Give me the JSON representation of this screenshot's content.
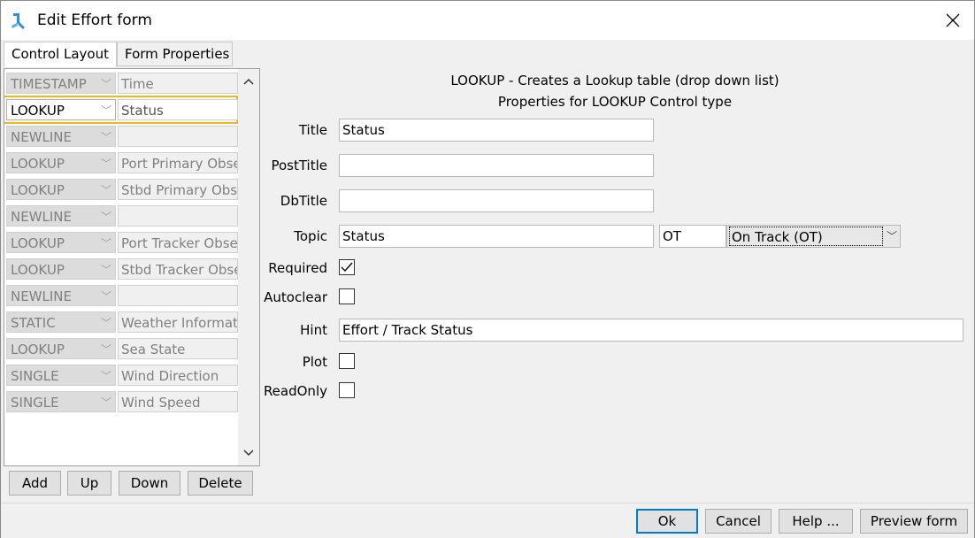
{
  "window": {
    "title": "Edit Effort form"
  },
  "tabs": [
    {
      "label": "Control Layout",
      "active": true
    },
    {
      "label": "Form Properties",
      "active": false
    }
  ],
  "controls": [
    {
      "type": "TIMESTAMP",
      "name": "Time"
    },
    {
      "type": "LOOKUP",
      "name": "Status",
      "selected": true
    },
    {
      "type": "NEWLINE",
      "name": ""
    },
    {
      "type": "LOOKUP",
      "name": "Port Primary Observer"
    },
    {
      "type": "LOOKUP",
      "name": "Stbd Primary Observer"
    },
    {
      "type": "NEWLINE",
      "name": ""
    },
    {
      "type": "LOOKUP",
      "name": "Port Tracker Observer"
    },
    {
      "type": "LOOKUP",
      "name": "Stbd Tracker Observer"
    },
    {
      "type": "NEWLINE",
      "name": ""
    },
    {
      "type": "STATIC",
      "name": "Weather Information"
    },
    {
      "type": "LOOKUP",
      "name": "Sea State"
    },
    {
      "type": "SINGLE",
      "name": "Wind Direction"
    },
    {
      "type": "SINGLE",
      "name": "Wind Speed"
    }
  ],
  "list_buttons": {
    "add": "Add",
    "up": "Up",
    "down": "Down",
    "delete": "Delete"
  },
  "properties": {
    "heading": "LOOKUP - Creates a Lookup table (drop down list)",
    "subheading": "Properties for LOOKUP Control type",
    "labels": {
      "title": "Title",
      "posttitle": "PostTitle",
      "dbtitle": "DbTitle",
      "topic": "Topic",
      "required": "Required",
      "autoclear": "Autoclear",
      "hint": "Hint",
      "plot": "Plot",
      "readonly": "ReadOnly"
    },
    "values": {
      "title": "Status",
      "posttitle": "",
      "dbtitle": "",
      "topic": "Status",
      "topic_code": "OT",
      "topic_option": "On Track (OT)",
      "hint": "Effort  / Track Status"
    },
    "checks": {
      "required": true,
      "autoclear": false,
      "plot": false,
      "readonly": false
    }
  },
  "dialog_buttons": {
    "ok": "Ok",
    "cancel": "Cancel",
    "help": "Help ...",
    "preview": "Preview form"
  },
  "icons": {
    "app": "app-logo-icon",
    "close": "close-icon",
    "check": "checkmark-icon",
    "chevron": "chevron-down-icon"
  }
}
